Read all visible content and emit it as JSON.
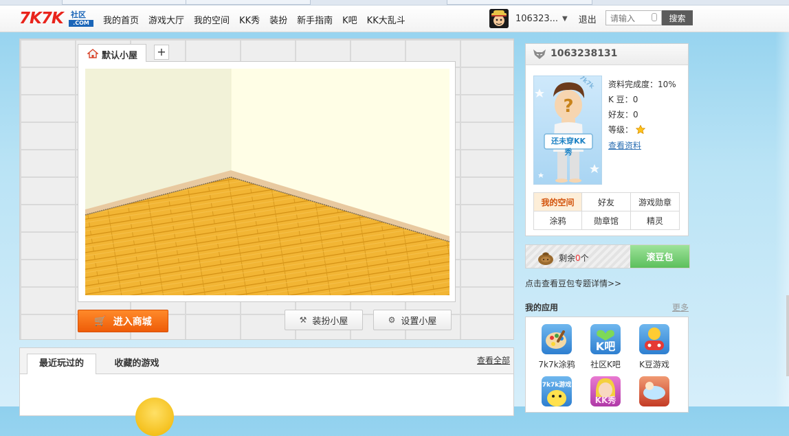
{
  "nav": {
    "logo_main": "7K7K",
    "logo_sub": "社区",
    "logo_com": ".COM",
    "items": [
      {
        "label": "我的首页"
      },
      {
        "label": "游戏大厅"
      },
      {
        "label": "我的空间"
      },
      {
        "label": "KK秀"
      },
      {
        "label": "装扮"
      },
      {
        "label": "新手指南"
      },
      {
        "label": "K吧"
      },
      {
        "label": "KK大乱斗"
      }
    ],
    "username": "106323...",
    "logout": "退出",
    "search_placeholder": "请输入",
    "search_button": "搜索"
  },
  "house": {
    "tab_label": "默认小屋",
    "add_tab": "+",
    "shop_button": "进入商城",
    "decorate_button": "装扮小屋",
    "settings_button": "设置小屋"
  },
  "games": {
    "tab_recent": "最近玩过的",
    "tab_favorites": "收藏的游戏",
    "view_all": "查看全部"
  },
  "profile": {
    "uid": "1063238131",
    "figure_sign": "还未穿KK秀",
    "figure_corner": "7k7k",
    "completion_label": "资料完成度：",
    "completion_value": "10%",
    "kbeans_label": "K 豆：",
    "kbeans_value": "0",
    "friends_label": "好友：",
    "friends_value": "0",
    "level_label": "等级：",
    "view_profile": "查看资料",
    "grid": [
      {
        "label": "我的空间",
        "active": true
      },
      {
        "label": "好友",
        "active": false
      },
      {
        "label": "游戏勋章",
        "active": false
      },
      {
        "label": "涂鸦",
        "active": false
      },
      {
        "label": "勋章馆",
        "active": false
      },
      {
        "label": "精灵",
        "active": false
      }
    ]
  },
  "beans": {
    "remaining_prefix": "剩余",
    "remaining_count": "0",
    "remaining_suffix": "个",
    "roll_button": "滚豆包",
    "detail_link": "点击查看豆包专题详情>>"
  },
  "apps": {
    "title": "我的应用",
    "more": "更多",
    "items": [
      {
        "label": "7k7k涂鸦",
        "icon": "palette-icon"
      },
      {
        "label": "社区K吧",
        "icon": "kba-heart-icon",
        "icon_text": "K吧"
      },
      {
        "label": "K豆游戏",
        "icon": "kbean-game-icon"
      },
      {
        "label": "",
        "icon": "7k7k-game-chick-icon",
        "icon_text": "7k7k游戏"
      },
      {
        "label": "",
        "icon": "kkshow-girl-icon",
        "icon_text": "KK秀"
      },
      {
        "label": "",
        "icon": "fighter-game-icon"
      }
    ]
  },
  "colors": {
    "brand_red": "#e9241c",
    "brand_blue": "#1a65b8",
    "shop_orange": "#ee5c08",
    "roll_green": "#5cbf5c",
    "active_tab_text": "#d2520a"
  }
}
